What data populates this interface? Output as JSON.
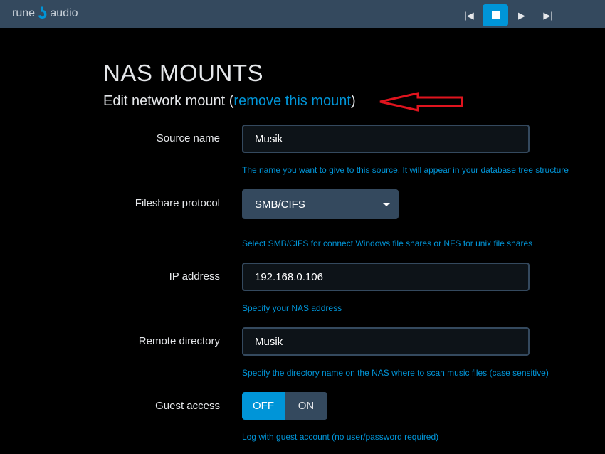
{
  "header": {
    "logo_left": "rune",
    "logo_right": "audio",
    "controls": [
      "previous-icon",
      "stop-icon",
      "play-icon",
      "next-icon"
    ],
    "active_control": "stop"
  },
  "page": {
    "title": "NAS MOUNTS",
    "subtitle_prefix": "Edit network mount (",
    "remove_link": "remove this mount",
    "subtitle_suffix": ")"
  },
  "form": {
    "source_name": {
      "label": "Source name",
      "value": "Musik",
      "help": "The name you want to give to this source. It will appear in your database tree structure"
    },
    "protocol": {
      "label": "Fileshare protocol",
      "value": "SMB/CIFS",
      "help": "Select SMB/CIFS for connect Windows file shares or NFS for unix file shares"
    },
    "ip": {
      "label": "IP address",
      "value": "192.168.0.106",
      "help": "Specify your NAS address"
    },
    "remote_dir": {
      "label": "Remote directory",
      "value": "Musik",
      "help": "Specify the directory name on the NAS where to scan music files (case sensitive)"
    },
    "guest": {
      "label": "Guest access",
      "off": "OFF",
      "on": "ON",
      "state": "OFF",
      "help": "Log with guest account (no user/password required)"
    }
  },
  "colors": {
    "accent": "#0095d8",
    "bar": "#34495e",
    "annotation": "#e0141e"
  }
}
